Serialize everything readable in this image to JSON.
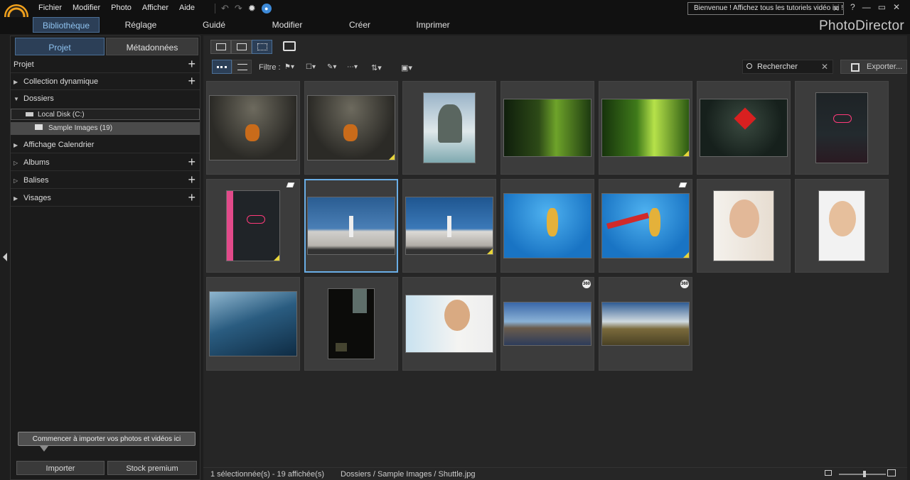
{
  "app": {
    "menu": [
      "Fichier",
      "Modifier",
      "Photo",
      "Afficher",
      "Aide"
    ],
    "banner": "Bienvenue ! Affichez tous les tutoriels vidéo ici !",
    "window_controls": [
      "?",
      "—",
      "▭",
      "✕"
    ],
    "brand": "PhotoDirector",
    "tabs": [
      "Bibliothèque",
      "Réglage",
      "Guidé",
      "Modifier",
      "Créer",
      "Imprimer"
    ],
    "active_tab": "Bibliothèque",
    "accent": "#4b6f96"
  },
  "left": {
    "tabs": [
      "Projet",
      "Métadonnées"
    ],
    "active_tab": "Projet",
    "tree": [
      {
        "label": "Projet",
        "tri": "",
        "plus": true
      },
      {
        "label": "Collection dynamique",
        "tri": "▶",
        "plus": true
      },
      {
        "label": "Dossiers",
        "tri": "▼",
        "plus": false
      },
      {
        "label": "Affichage Calendrier",
        "tri": "▶",
        "plus": false
      },
      {
        "label": "Albums",
        "tri": "▷",
        "plus": true
      },
      {
        "label": "Balises",
        "tri": "▷",
        "plus": true
      },
      {
        "label": "Visages",
        "tri": "▶",
        "plus": true
      }
    ],
    "disk": "Local Disk (C:)",
    "folder": "Sample Images (19)",
    "import_tip": "Commencer à importer vos photos et vidéos ici",
    "import_button": "Importer",
    "stock_button": "Stock premium"
  },
  "toolbar": {
    "filter_label": "Filtre :",
    "search": "Rechercher",
    "export": "Exporter..."
  },
  "thumbnails": [
    {
      "name": "basketball-dunk",
      "corner": false
    },
    {
      "name": "basketball-dunk-edited",
      "corner": true
    },
    {
      "name": "sea-rock",
      "corner": false
    },
    {
      "name": "forest",
      "corner": false
    },
    {
      "name": "forest-edited",
      "corner": true
    },
    {
      "name": "red-leaf",
      "corner": false
    },
    {
      "name": "neon-cafe",
      "corner": false
    },
    {
      "name": "neon-cafe-pink",
      "corner": true,
      "stack": true
    },
    {
      "name": "shuttle",
      "corner": false,
      "selected": true
    },
    {
      "name": "shuttle-edited",
      "corner": true
    },
    {
      "name": "skateboarder",
      "corner": false
    },
    {
      "name": "skateboarder-text",
      "corner": true,
      "stack": true
    },
    {
      "name": "woman-portrait",
      "corner": false
    },
    {
      "name": "woman-smiling",
      "corner": false
    },
    {
      "name": "wave",
      "corner": false
    },
    {
      "name": "dark-window",
      "corner": false
    },
    {
      "name": "woman-sofa",
      "corner": false
    },
    {
      "name": "panorama-360-a",
      "corner": false,
      "badge": "360"
    },
    {
      "name": "panorama-360-b",
      "corner": false,
      "badge": "360"
    }
  ],
  "status": {
    "selection": "1 sélectionnée(s) - 19 affichée(s)",
    "path": "Dossiers / Sample Images / Shuttle.jpg",
    "zoom_fraction": 0.55
  }
}
